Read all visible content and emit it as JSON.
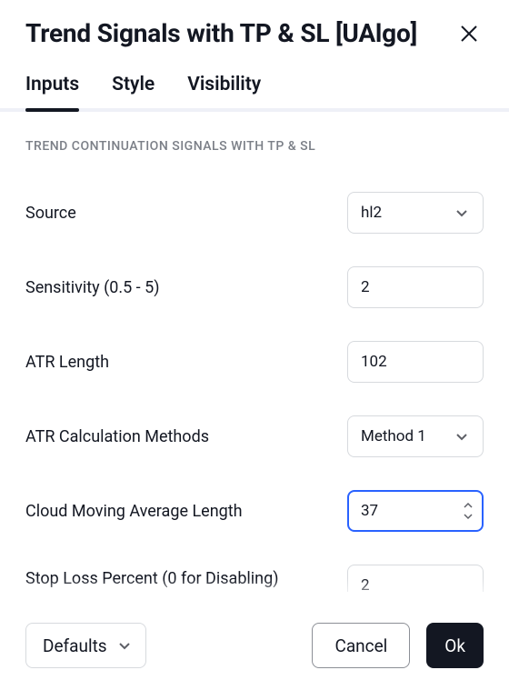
{
  "header": {
    "title": "Trend Signals with TP & SL [UAlgo]"
  },
  "tabs": {
    "items": [
      "Inputs",
      "Style",
      "Visibility"
    ],
    "active": 0
  },
  "section": {
    "heading": "TREND CONTINUATION SIGNALS WITH TP & SL"
  },
  "fields": {
    "source": {
      "label": "Source",
      "value": "hl2",
      "type": "select"
    },
    "sensitivity": {
      "label": "Sensitivity (0.5 - 5)",
      "value": "2",
      "type": "number"
    },
    "atr_length": {
      "label": "ATR Length",
      "value": "102",
      "type": "number"
    },
    "atr_method": {
      "label": "ATR Calculation Methods",
      "value": "Method 1",
      "type": "select"
    },
    "cloud_ma": {
      "label": "Cloud Moving Average Length",
      "value": "37",
      "type": "number",
      "focused": true
    },
    "stop_loss": {
      "label": "Stop Loss Percent (0 for Disabling)",
      "value": "2",
      "type": "number"
    }
  },
  "footer": {
    "defaults": "Defaults",
    "cancel": "Cancel",
    "ok": "Ok"
  }
}
